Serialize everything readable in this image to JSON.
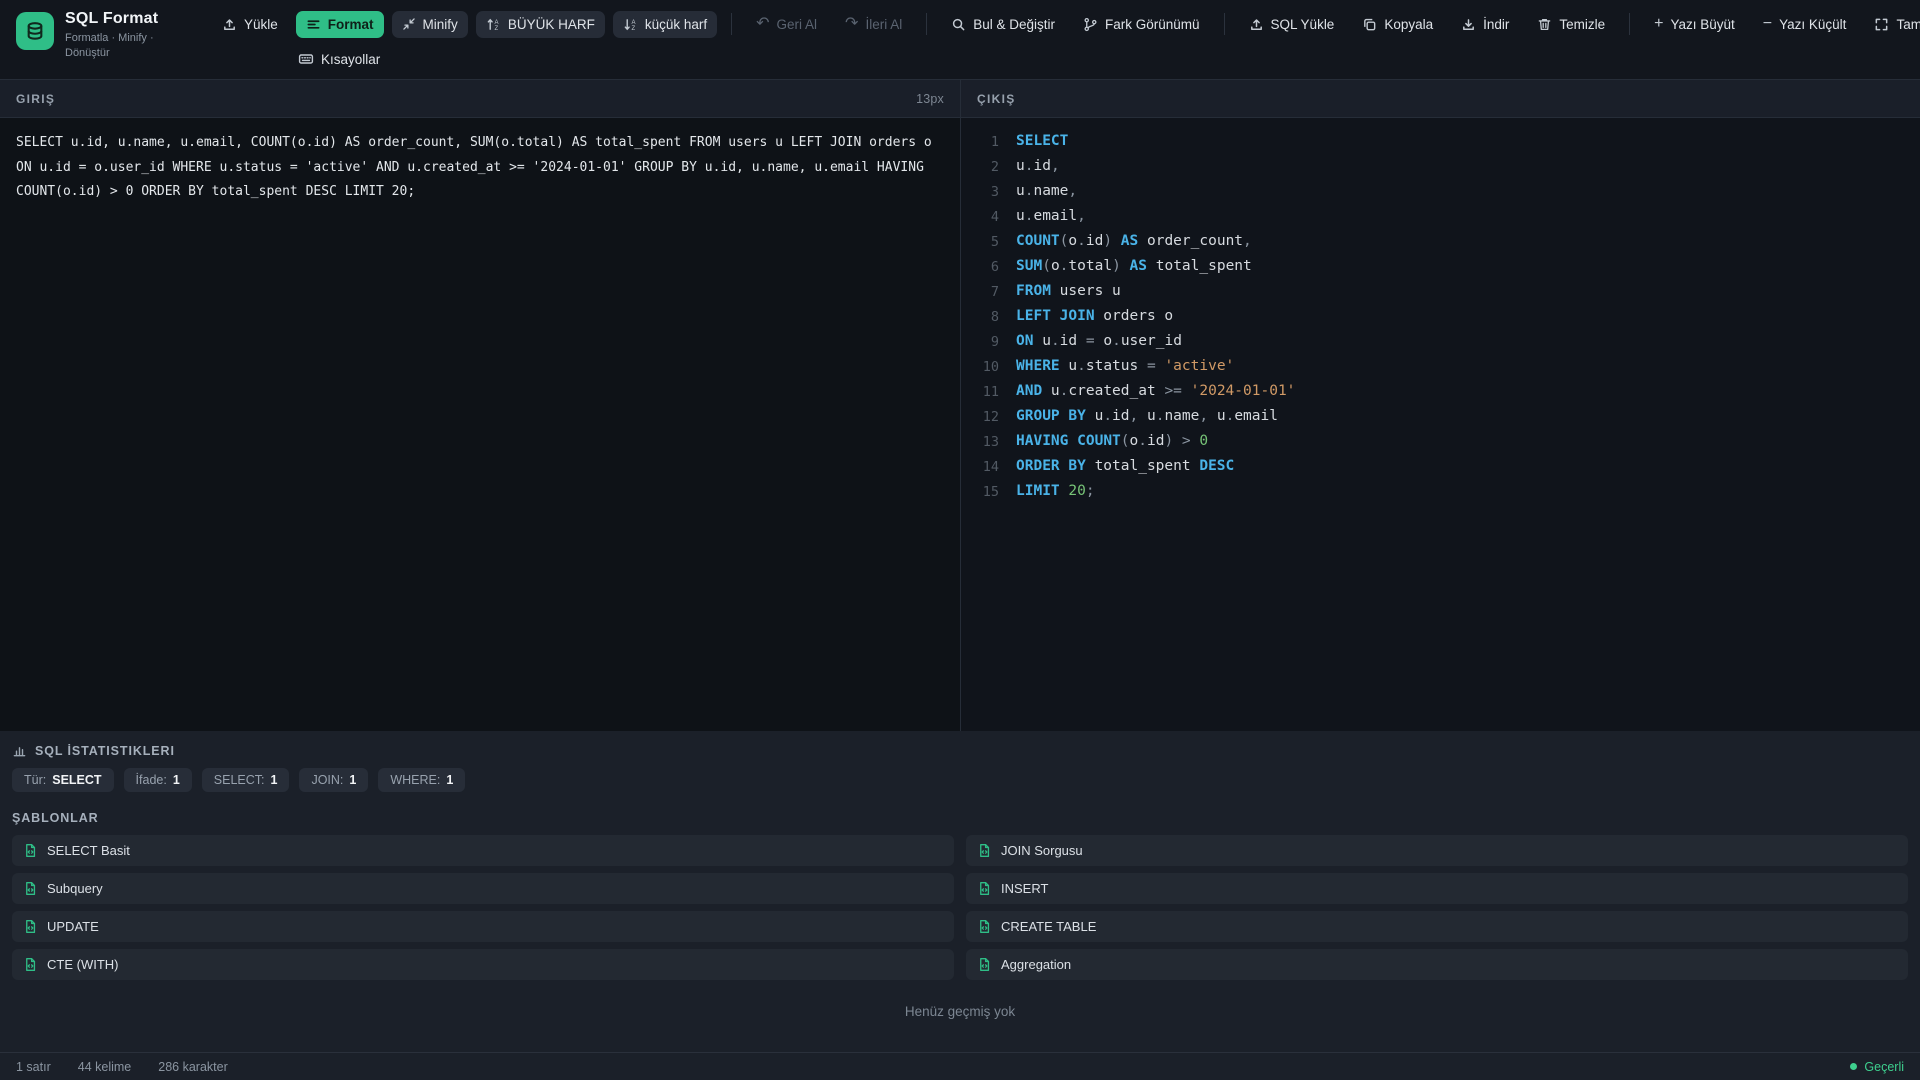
{
  "brand": {
    "title": "SQL Format",
    "subtitle": "Formatla · Minify · Dönüştür"
  },
  "toolbar": {
    "upload": "Yükle",
    "format": "Format",
    "minify": "Minify",
    "uppercase": "BÜYÜK HARF",
    "lowercase": "küçük harf",
    "undo": "Geri Al",
    "redo": "İleri Al",
    "find_replace": "Bul & Değiştir",
    "diff_view": "Fark Görünümü",
    "load_sql": "SQL Yükle",
    "copy": "Kopyala",
    "download": "İndir",
    "clear": "Temizle",
    "font_increase": "Yazı Büyüt",
    "font_decrease": "Yazı Küçült",
    "fullscreen": "Tam Ekran",
    "shortcuts": "Kısayollar"
  },
  "input_panel": {
    "title": "GIRIŞ",
    "font_size_label": "13px",
    "sql": "SELECT u.id, u.name, u.email, COUNT(o.id) AS order_count, SUM(o.total) AS total_spent FROM users u LEFT JOIN orders o ON u.id = o.user_id WHERE u.status = 'active' AND u.created_at >= '2024-01-01' GROUP BY u.id, u.name, u.email HAVING COUNT(o.id) > 0 ORDER BY total_spent DESC LIMIT 20;"
  },
  "output_panel": {
    "title": "ÇIKIŞ",
    "lines": [
      [
        [
          "kw",
          "SELECT"
        ]
      ],
      [
        [
          "id",
          "u"
        ],
        [
          "pun",
          "."
        ],
        [
          "id",
          "id"
        ],
        [
          "pun",
          ","
        ]
      ],
      [
        [
          "id",
          "u"
        ],
        [
          "pun",
          "."
        ],
        [
          "id",
          "name"
        ],
        [
          "pun",
          ","
        ]
      ],
      [
        [
          "id",
          "u"
        ],
        [
          "pun",
          "."
        ],
        [
          "id",
          "email"
        ],
        [
          "pun",
          ","
        ]
      ],
      [
        [
          "kw",
          "COUNT"
        ],
        [
          "pun",
          "("
        ],
        [
          "id",
          "o"
        ],
        [
          "pun",
          "."
        ],
        [
          "id",
          "id"
        ],
        [
          "pun",
          ") "
        ],
        [
          "kw",
          "AS"
        ],
        [
          "id",
          " order_count"
        ],
        [
          "pun",
          ","
        ]
      ],
      [
        [
          "kw",
          "SUM"
        ],
        [
          "pun",
          "("
        ],
        [
          "id",
          "o"
        ],
        [
          "pun",
          "."
        ],
        [
          "id",
          "total"
        ],
        [
          "pun",
          ") "
        ],
        [
          "kw",
          "AS"
        ],
        [
          "id",
          " total_spent"
        ]
      ],
      [
        [
          "kw",
          "FROM"
        ],
        [
          "id",
          " users u"
        ]
      ],
      [
        [
          "kw",
          "LEFT JOIN"
        ],
        [
          "id",
          " orders o"
        ]
      ],
      [
        [
          "kw",
          "ON"
        ],
        [
          "id",
          " u"
        ],
        [
          "pun",
          "."
        ],
        [
          "id",
          "id"
        ],
        [
          "pun",
          " = "
        ],
        [
          "id",
          "o"
        ],
        [
          "pun",
          "."
        ],
        [
          "id",
          "user_id"
        ]
      ],
      [
        [
          "kw",
          "WHERE"
        ],
        [
          "id",
          " u"
        ],
        [
          "pun",
          "."
        ],
        [
          "id",
          "status"
        ],
        [
          "pun",
          " = "
        ],
        [
          "str",
          "'active'"
        ]
      ],
      [
        [
          "kw",
          "AND"
        ],
        [
          "id",
          " u"
        ],
        [
          "pun",
          "."
        ],
        [
          "id",
          "created_at"
        ],
        [
          "pun",
          " >= "
        ],
        [
          "str",
          "'2024-01-01'"
        ]
      ],
      [
        [
          "kw",
          "GROUP BY"
        ],
        [
          "id",
          " u"
        ],
        [
          "pun",
          "."
        ],
        [
          "id",
          "id"
        ],
        [
          "pun",
          ","
        ],
        [
          "id",
          " u"
        ],
        [
          "pun",
          "."
        ],
        [
          "id",
          "name"
        ],
        [
          "pun",
          ","
        ],
        [
          "id",
          " u"
        ],
        [
          "pun",
          "."
        ],
        [
          "id",
          "email"
        ]
      ],
      [
        [
          "kw",
          "HAVING"
        ],
        [
          "id",
          " "
        ],
        [
          "kw",
          "COUNT"
        ],
        [
          "pun",
          "("
        ],
        [
          "id",
          "o"
        ],
        [
          "pun",
          "."
        ],
        [
          "id",
          "id"
        ],
        [
          "pun",
          ") > "
        ],
        [
          "num",
          "0"
        ]
      ],
      [
        [
          "kw",
          "ORDER BY"
        ],
        [
          "id",
          " total_spent "
        ],
        [
          "kw",
          "DESC"
        ]
      ],
      [
        [
          "kw",
          "LIMIT"
        ],
        [
          "num",
          " 20"
        ],
        [
          "pun",
          ";"
        ]
      ]
    ]
  },
  "stats": {
    "title": "SQL İSTATISTIKLERI",
    "badges": [
      {
        "label": "Tür:",
        "value": "SELECT"
      },
      {
        "label": "İfade:",
        "value": "1"
      },
      {
        "label": "SELECT:",
        "value": "1"
      },
      {
        "label": "JOIN:",
        "value": "1"
      },
      {
        "label": "WHERE:",
        "value": "1"
      }
    ]
  },
  "templates": {
    "title": "ŞABLONLAR",
    "items": [
      "SELECT Basit",
      "JOIN Sorgusu",
      "Subquery",
      "INSERT",
      "UPDATE",
      "CREATE TABLE",
      "CTE (WITH)",
      "Aggregation"
    ]
  },
  "history": {
    "empty_text": "Henüz geçmiş yok"
  },
  "footer": {
    "lines": "1 satır",
    "words": "44 kelime",
    "chars": "286 karakter",
    "status": "Geçerli"
  },
  "colors": {
    "accent": "#2fbe87",
    "keyword": "#4ab3e8",
    "string": "#d19a66",
    "number": "#77c477",
    "status_ok": "#3ecf8e"
  }
}
